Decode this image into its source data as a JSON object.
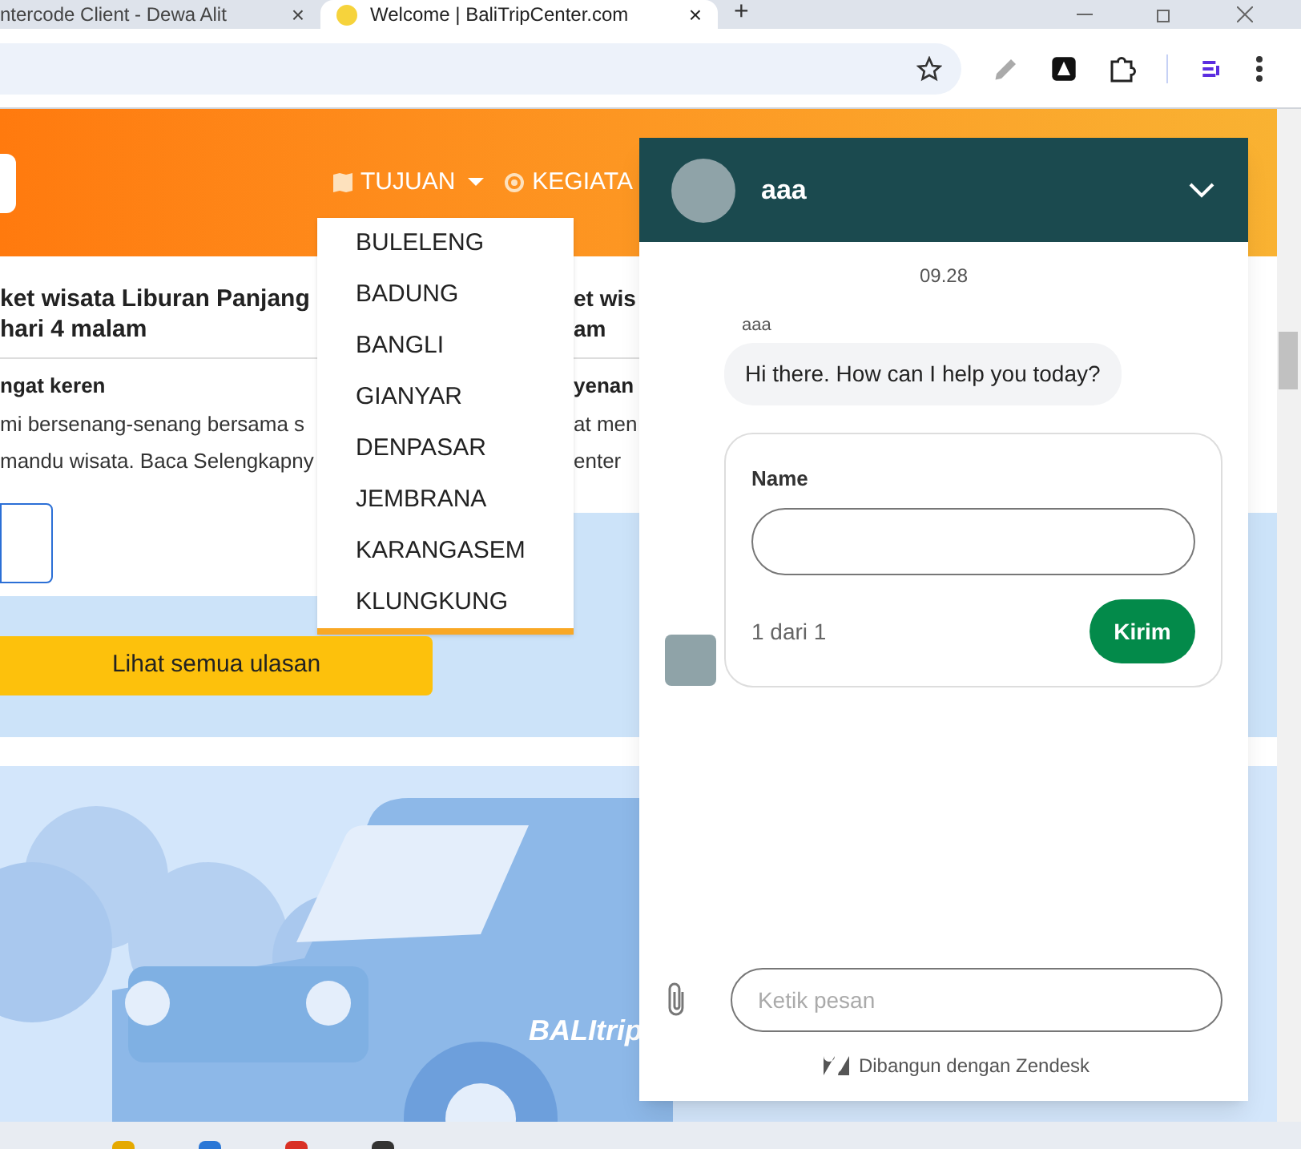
{
  "browser": {
    "tabs": [
      {
        "title": "ntercode Client - Dewa Alit",
        "close": "×",
        "selected": false
      },
      {
        "title": "Welcome | BaliTripCenter.com",
        "close": "×",
        "selected": true
      }
    ],
    "new_tab": "+"
  },
  "nav": {
    "items": [
      {
        "label": "TUJUAN",
        "kind": "dropdown"
      },
      {
        "label": "KEGIATA",
        "kind": "link"
      }
    ]
  },
  "dropdown": {
    "items": [
      "BULELENG",
      "BADUNG",
      "BANGLI",
      "GIANYAR",
      "DENPASAR",
      "JEMBRANA",
      "KARANGASEM",
      "KLUNGKUNG"
    ]
  },
  "cards": [
    {
      "title": "ket wisata Liburan Panjang\nhari 4 malam",
      "subtitle": "ngat keren",
      "text": [
        "mi bersenang-senang bersama s",
        "mandu wisata. Baca Selengkapny"
      ]
    },
    {
      "title": "et wis\nam",
      "subtitle": "yenan",
      "text": [
        "at men",
        "enter"
      ]
    }
  ],
  "reviews_button": "Lihat semua ulasan",
  "van_logo": "BALItrip",
  "chat": {
    "agent": "aaa",
    "time": "09.28",
    "sender": "aaa",
    "message": "Hi there. How can I help you today?",
    "form": {
      "label": "Name",
      "step": "1 dari 1",
      "submit": "Kirim"
    },
    "composer_placeholder": "Ketik pesan",
    "footer": "Dibangun dengan Zendesk"
  }
}
